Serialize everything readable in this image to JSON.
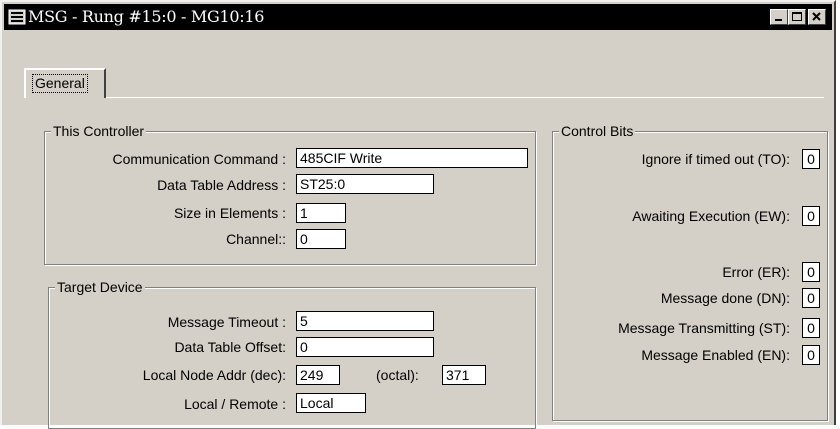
{
  "window": {
    "title": "MSG - Rung #15:0 - MG10:16"
  },
  "titlebar_buttons": [
    "minimize-button",
    "maximize-button",
    "close-button"
  ],
  "tabs": [
    {
      "label": "General",
      "active": true
    }
  ],
  "this_controller": {
    "title": "This Controller",
    "comm_command_label": "Communication Command :",
    "comm_command_value": "485CIF Write",
    "data_table_address_label": "Data Table Address :",
    "data_table_address_value": "ST25:0",
    "size_label": "Size in Elements :",
    "size_value": "1",
    "channel_label": "Channel::",
    "channel_value": "0"
  },
  "target_device": {
    "title": "Target Device",
    "timeout_label": "Message Timeout :",
    "timeout_value": "5",
    "offset_label": "Data Table Offset:",
    "offset_value": "0",
    "node_addr_label": "Local Node Addr (dec):",
    "node_addr_dec": "249",
    "octal_label": "(octal):",
    "node_addr_octal": "371",
    "local_remote_label": "Local / Remote :",
    "local_remote_value": "Local"
  },
  "control_bits": {
    "title": "Control Bits",
    "ignore_label": "Ignore if timed out (TO):",
    "ignore_value": "0",
    "awaiting_label": "Awaiting Execution (EW):",
    "awaiting_value": "0",
    "error_label": "Error (ER):",
    "error_value": "0",
    "done_label": "Message done (DN):",
    "done_value": "0",
    "transmitting_label": "Message Transmitting (ST):",
    "transmitting_value": "0",
    "enabled_label": "Message Enabled (EN):",
    "enabled_value": "0"
  },
  "colors": {
    "face": "#d4d0c8",
    "titlebar": "#000000",
    "title_text": "#ffffff"
  }
}
